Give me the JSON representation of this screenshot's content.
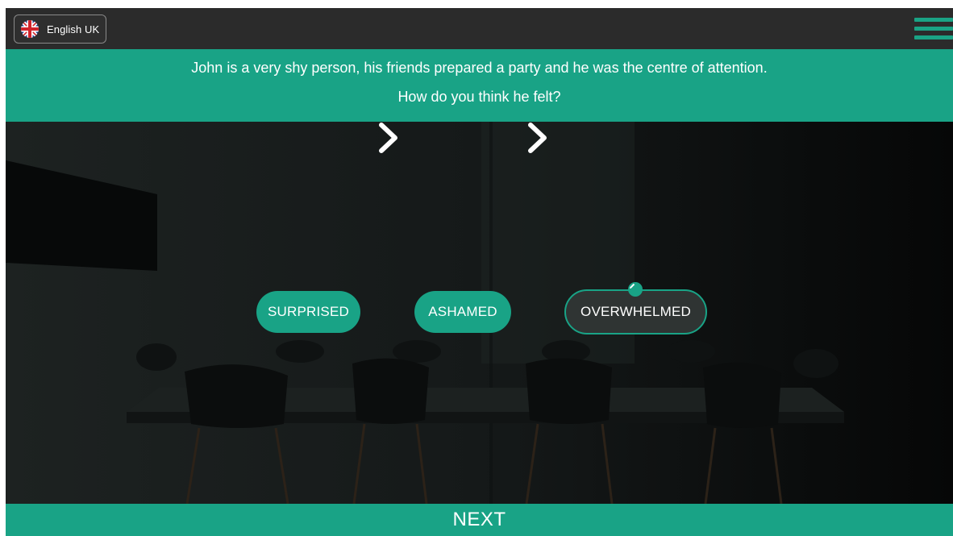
{
  "language": {
    "label": "English UK",
    "flag_icon": "uk-flag-icon"
  },
  "menu": {
    "icon": "hamburger-menu-icon",
    "color": "#1aa385"
  },
  "question": {
    "line1": "John is a very shy person, his friends prepared a party and he was the centre of attention.",
    "line2": "How do you think he felt?"
  },
  "emotions": [
    {
      "label": "SURPRISED",
      "state": "selected"
    },
    {
      "label": "ASHAMED",
      "state": "selected"
    },
    {
      "label": "OVERWHELMED",
      "state": "active-editable"
    }
  ],
  "separator_icon": "chevron-right-icon",
  "edit_icon": "pencil-icon",
  "next": {
    "label": "NEXT"
  },
  "colors": {
    "accent": "#19a386",
    "topbar": "#2b2b2b",
    "chip_active_bg": "#2f3433"
  }
}
